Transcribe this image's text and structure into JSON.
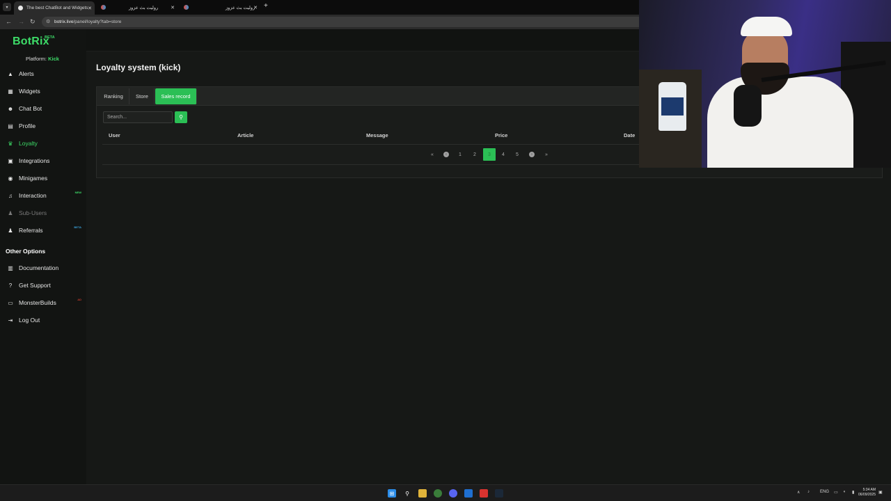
{
  "browser": {
    "tabs": [
      {
        "title": "The best ChatBot and Widgets",
        "active": true
      },
      {
        "title": "روليت بث عزوز",
        "active": false
      },
      {
        "title": "روليت بث عزوز",
        "active": false
      }
    ],
    "url_host": "botrix.live",
    "url_path": "/panel/loyalty?tab=store"
  },
  "sidebar": {
    "logo": "BotRix",
    "logo_badge": "BETA",
    "platform_label": "Platform:",
    "platform_value": "Kick",
    "items": [
      {
        "label": "Alerts",
        "icon": "warning-icon",
        "glyph": "▲",
        "state": "normal",
        "badge": ""
      },
      {
        "label": "Widgets",
        "icon": "widgets-icon",
        "glyph": "▦",
        "state": "normal",
        "badge": ""
      },
      {
        "label": "Chat Bot",
        "icon": "robot-icon",
        "glyph": "☻",
        "state": "normal",
        "badge": ""
      },
      {
        "label": "Profile",
        "icon": "profile-card-icon",
        "glyph": "▤",
        "state": "normal",
        "badge": ""
      },
      {
        "label": "Loyalty",
        "icon": "trophy-icon",
        "glyph": "♛",
        "state": "active",
        "badge": ""
      },
      {
        "label": "Integrations",
        "icon": "integrations-icon",
        "glyph": "▣",
        "state": "normal",
        "badge": ""
      },
      {
        "label": "Minigames",
        "icon": "gamepad-icon",
        "glyph": "◉",
        "state": "normal",
        "badge": ""
      },
      {
        "label": "Interaction",
        "icon": "music-note-icon",
        "glyph": "♫",
        "state": "normal",
        "badge": "NEW"
      },
      {
        "label": "Sub-Users",
        "icon": "users-icon",
        "glyph": "♟",
        "state": "disabled",
        "badge": ""
      },
      {
        "label": "Referrals",
        "icon": "referral-users-icon",
        "glyph": "♟",
        "state": "normal",
        "badge": "BETA"
      }
    ],
    "other_title": "Other Options",
    "other_items": [
      {
        "label": "Documentation",
        "icon": "book-icon",
        "glyph": "▥"
      },
      {
        "label": "Get Support",
        "icon": "question-icon",
        "glyph": "?"
      },
      {
        "label": "MonsterBuilds",
        "icon": "laptop-icon",
        "glyph": "▭",
        "badge": "AD"
      },
      {
        "label": "Log Out",
        "icon": "logout-icon",
        "glyph": "⇥"
      }
    ]
  },
  "main": {
    "title": "Loyalty system (kick)",
    "tabs": [
      "Ranking",
      "Store",
      "Sales record"
    ],
    "active_tab": "Sales record",
    "search_placeholder": "Search...",
    "columns": [
      "User",
      "Article",
      "Message",
      "Price",
      "Date"
    ],
    "pagination": {
      "first": "«",
      "prev": "‹",
      "pages": [
        "1",
        "2",
        "3",
        "4",
        "5"
      ],
      "current": "3",
      "next": "›",
      "last": "»"
    }
  },
  "taskbar": {
    "lang": "ENG",
    "time": "5:34 AM",
    "date": "06/09/2025"
  },
  "colors": {
    "accent": "#2bbf55",
    "logo": "#3ddc68",
    "background": "#161816"
  }
}
